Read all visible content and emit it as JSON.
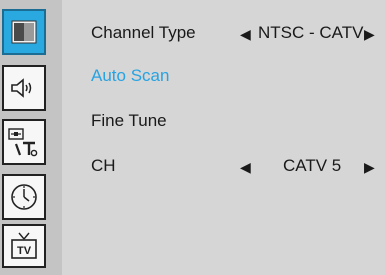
{
  "sidebar": {
    "items": [
      {
        "icon": "picture-icon",
        "active": true
      },
      {
        "icon": "speaker-icon",
        "active": false
      },
      {
        "icon": "settings-tools-icon",
        "active": false
      },
      {
        "icon": "clock-icon",
        "active": false
      },
      {
        "icon": "tv-icon",
        "active": false,
        "label": "TV"
      }
    ]
  },
  "menu": {
    "rows": [
      {
        "label": "Channel Type",
        "value": "NTSC - CATV",
        "left_arrow": "◀",
        "right_arrow": "▶"
      },
      {
        "label": "Auto Scan"
      },
      {
        "label": "Fine Tune"
      },
      {
        "label": "CH",
        "value": "CATV 5",
        "left_arrow": "◀",
        "right_arrow": "▶"
      }
    ],
    "highlight_color": "#27a3e3",
    "accent_color": "#2aa8e0"
  }
}
